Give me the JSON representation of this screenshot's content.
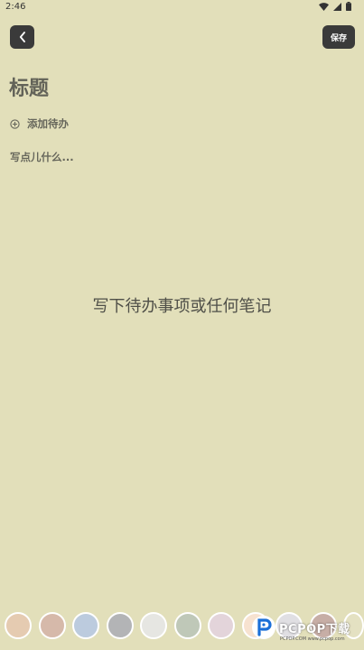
{
  "status": {
    "time": "2:46"
  },
  "header": {
    "save_label": "保存"
  },
  "note": {
    "title_placeholder": "标题",
    "add_todo_label": "添加待办",
    "content_placeholder": "写点儿什么...",
    "empty_hint": "写下待办事项或任何笔记"
  },
  "palette": [
    {
      "color": "#e5cbb1"
    },
    {
      "color": "#d6b9aa"
    },
    {
      "color": "#bccbde"
    },
    {
      "color": "#b3b4b6"
    },
    {
      "color": "#e6e6e2"
    },
    {
      "color": "#bfc8b8"
    },
    {
      "color": "#e3d4da"
    },
    {
      "color": "#f7e2d0"
    },
    {
      "color": "#e0dfe3"
    },
    {
      "color": "#c7aea6"
    },
    {
      "color": "#e4e1c2"
    }
  ],
  "watermark": {
    "text": "PCPOP下载",
    "sub": "PCPOP.COM  www.pcpop.com"
  },
  "colors": {
    "background": "#e2dfba",
    "button": "#3a3a3a"
  }
}
